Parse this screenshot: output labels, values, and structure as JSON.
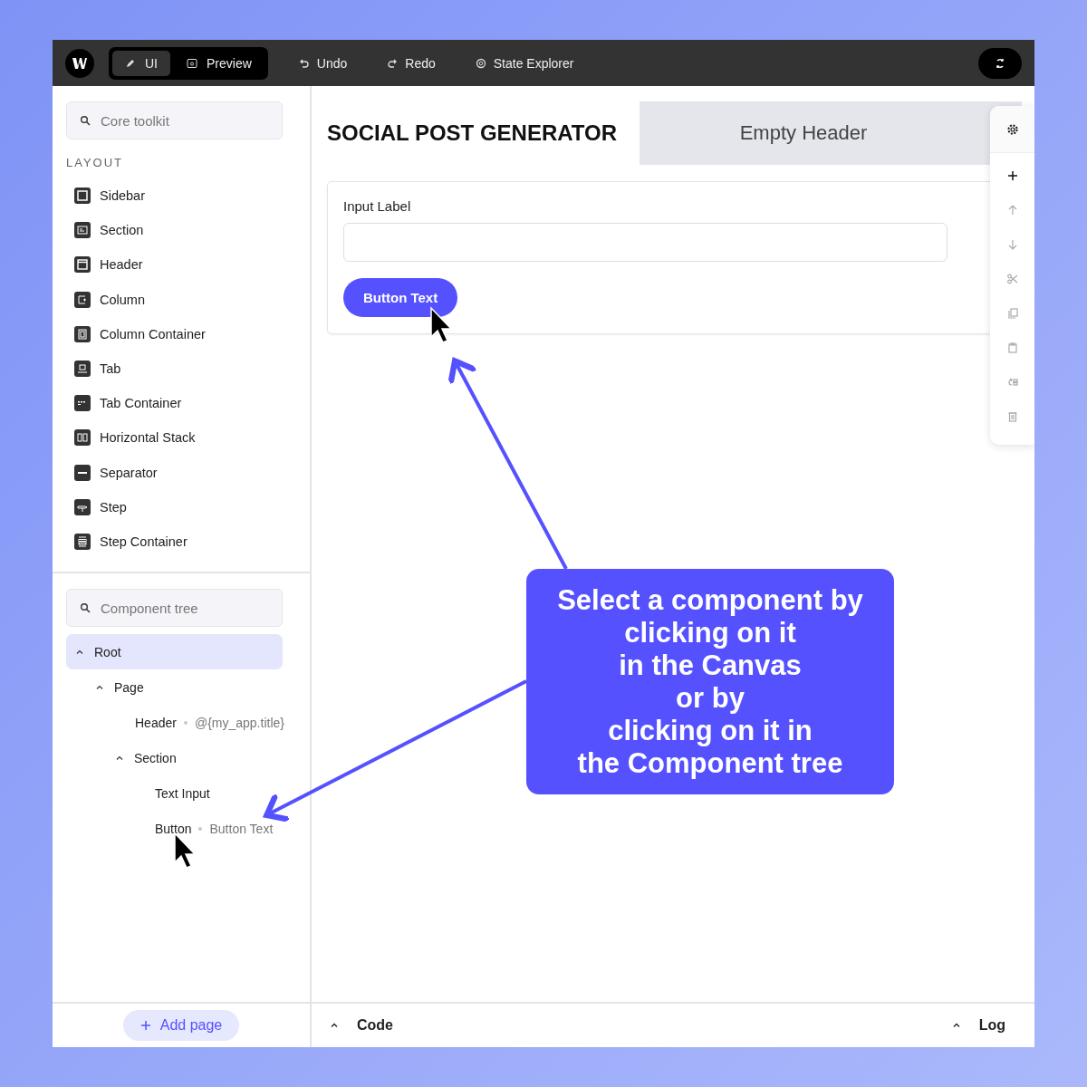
{
  "toolbar": {
    "modes": [
      {
        "label": "UI",
        "kind": "brush",
        "selected": true
      },
      {
        "label": "Preview",
        "kind": "eye",
        "selected": false
      }
    ],
    "actions": [
      {
        "label": "Undo",
        "kind": "undo"
      },
      {
        "label": "Redo",
        "kind": "redo"
      },
      {
        "label": "State Explorer",
        "kind": "explore"
      }
    ]
  },
  "toolkit": {
    "search_placeholder": "Core toolkit",
    "section_title": "LAYOUT",
    "items": [
      {
        "label": "Sidebar",
        "kind": "sidebar"
      },
      {
        "label": "Section",
        "kind": "section"
      },
      {
        "label": "Header",
        "kind": "header"
      },
      {
        "label": "Column",
        "kind": "column"
      },
      {
        "label": "Column Container",
        "kind": "colcontainer"
      },
      {
        "label": "Tab",
        "kind": "tab"
      },
      {
        "label": "Tab Container",
        "kind": "tabcontainer"
      },
      {
        "label": "Horizontal Stack",
        "kind": "hstack"
      },
      {
        "label": "Separator",
        "kind": "separator"
      },
      {
        "label": "Step",
        "kind": "step"
      },
      {
        "label": "Step Container",
        "kind": "stepcontainer"
      }
    ]
  },
  "component_tree": {
    "search_placeholder": "Component tree",
    "nodes": [
      {
        "label": "Root",
        "selected": true,
        "expanded": true,
        "children": [
          {
            "label": "Page",
            "selected": false,
            "expanded": true,
            "children": [
              {
                "label": "Header",
                "detail": "@{my_app.title}",
                "selected": false
              },
              {
                "label": "Section",
                "selected": false,
                "expanded": true,
                "children": [
                  {
                    "label": "Text Input",
                    "selected": false
                  },
                  {
                    "label": "Button",
                    "detail": "Button Text",
                    "selected": false
                  }
                ]
              }
            ]
          }
        ]
      }
    ]
  },
  "add_page": "Add page",
  "canvas": {
    "title": "SOCIAL POST GENERATOR",
    "header_tab": "Empty Header",
    "section": {
      "input_label": "Input Label",
      "button": "Button Text"
    }
  },
  "component_tools": [
    {
      "kind": "settings",
      "disabled": false
    },
    {
      "kind": "add",
      "disabled": false
    },
    {
      "kind": "up",
      "disabled": true
    },
    {
      "kind": "down",
      "disabled": true
    },
    {
      "kind": "cut",
      "disabled": true
    },
    {
      "kind": "copy",
      "disabled": true
    },
    {
      "kind": "paste",
      "disabled": true
    },
    {
      "kind": "goto",
      "disabled": true
    },
    {
      "kind": "delete",
      "disabled": true
    }
  ],
  "bottom_panels": [
    {
      "label": "Code",
      "expanded": false
    },
    {
      "label": "Log",
      "expanded": false
    }
  ],
  "callout": [
    "Select a component by",
    "clicking on it",
    "in the Canvas",
    "or by",
    "clicking on it in",
    "the Component tree"
  ]
}
